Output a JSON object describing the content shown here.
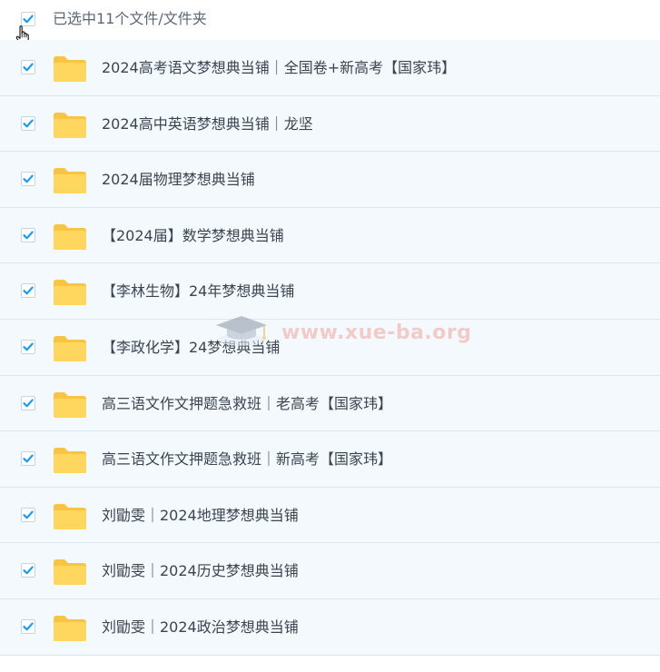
{
  "header": {
    "checked": true,
    "selection_label": "已选中11个文件/文件夹"
  },
  "colors": {
    "checkbox_check": "#1e9bef",
    "folder_back": "#f9c444",
    "folder_front": "#ffd75e",
    "row_bg": "#f4f9fe",
    "row_border": "#d6e6f5"
  },
  "icons": {
    "row_icon": "folder-icon",
    "check": "checkmark-icon",
    "cursor": "hand-pointer-icon"
  },
  "items": [
    {
      "name": "2024高考语文梦想典当铺｜全国卷+新高考【国家玮】",
      "checked": true
    },
    {
      "name": "2024高中英语梦想典当铺｜龙坚",
      "checked": true
    },
    {
      "name": "2024届物理梦想典当铺",
      "checked": true
    },
    {
      "name": "【2024届】数学梦想典当铺",
      "checked": true
    },
    {
      "name": "【李林生物】24年梦想典当铺",
      "checked": true
    },
    {
      "name": "【李政化学】24梦想典当铺",
      "checked": true
    },
    {
      "name": "高三语文作文押题急救班｜老高考【国家玮】",
      "checked": true
    },
    {
      "name": "高三语文作文押题急救班｜新高考【国家玮】",
      "checked": true
    },
    {
      "name": "刘勖雯｜2024地理梦想典当铺",
      "checked": true
    },
    {
      "name": "刘勖雯｜2024历史梦想典当铺",
      "checked": true
    },
    {
      "name": "刘勖雯｜2024政治梦想典当铺",
      "checked": true
    }
  ],
  "watermark": {
    "text": "www.xue-ba.org"
  }
}
